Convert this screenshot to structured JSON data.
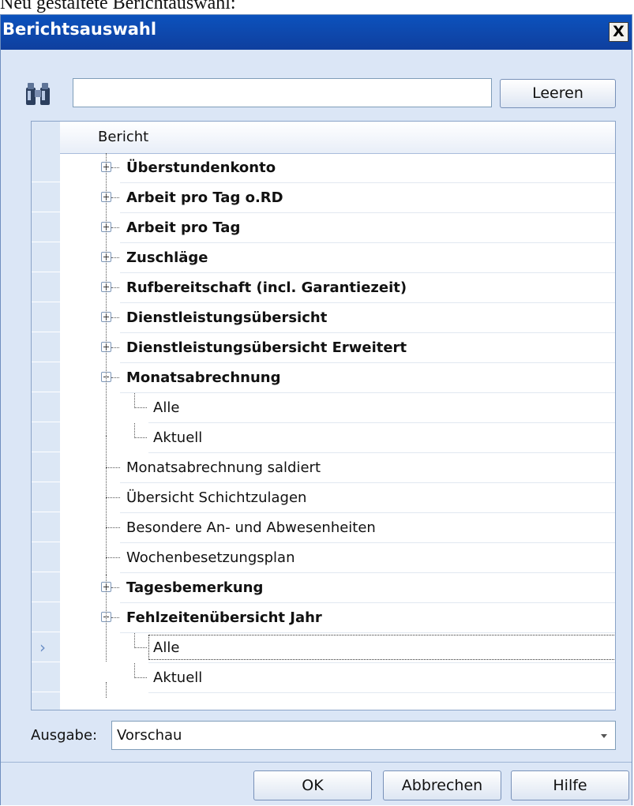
{
  "caption": "Neu gestaltete Berichtauswahl:",
  "dialog": {
    "title": "Berichtsauswahl",
    "close_label": "X"
  },
  "search": {
    "value": "",
    "placeholder": "",
    "clear_label": "Leeren"
  },
  "grid": {
    "header": "Bericht",
    "rows": [
      {
        "label": "Überstundenkonto",
        "level": 0,
        "bold": true,
        "expander": "plus"
      },
      {
        "label": "Arbeit pro Tag o.RD",
        "level": 0,
        "bold": true,
        "expander": "plus"
      },
      {
        "label": "Arbeit pro Tag",
        "level": 0,
        "bold": true,
        "expander": "plus"
      },
      {
        "label": "Zuschläge",
        "level": 0,
        "bold": true,
        "expander": "plus"
      },
      {
        "label": "Rufbereitschaft (incl. Garantiezeit)",
        "level": 0,
        "bold": true,
        "expander": "plus"
      },
      {
        "label": "Dienstleistungsübersicht",
        "level": 0,
        "bold": true,
        "expander": "plus"
      },
      {
        "label": "Dienstleistungsübersicht Erweitert",
        "level": 0,
        "bold": true,
        "expander": "plus"
      },
      {
        "label": "Monatsabrechnung",
        "level": 0,
        "bold": true,
        "expander": "minus"
      },
      {
        "label": "Alle",
        "level": 1,
        "bold": false,
        "expander": ""
      },
      {
        "label": "Aktuell",
        "level": 1,
        "bold": false,
        "expander": ""
      },
      {
        "label": "Monatsabrechnung saldiert",
        "level": 0,
        "bold": false,
        "expander": ""
      },
      {
        "label": "Übersicht Schichtzulagen",
        "level": 0,
        "bold": false,
        "expander": ""
      },
      {
        "label": "Besondere An- und Abwesenheiten",
        "level": 0,
        "bold": false,
        "expander": ""
      },
      {
        "label": "Wochenbesetzungsplan",
        "level": 0,
        "bold": false,
        "expander": ""
      },
      {
        "label": "Tagesbemerkung",
        "level": 0,
        "bold": true,
        "expander": "plus"
      },
      {
        "label": "Fehlzeitenübersicht Jahr",
        "level": 0,
        "bold": true,
        "expander": "minus"
      },
      {
        "label": "Alle",
        "level": 1,
        "bold": false,
        "expander": "",
        "current": true
      },
      {
        "label": "Aktuell",
        "level": 1,
        "bold": false,
        "expander": ""
      }
    ]
  },
  "output": {
    "label": "Ausgabe:",
    "value": "Vorschau"
  },
  "buttons": {
    "ok": "OK",
    "cancel": "Abbrechen",
    "help": "Hilfe"
  }
}
